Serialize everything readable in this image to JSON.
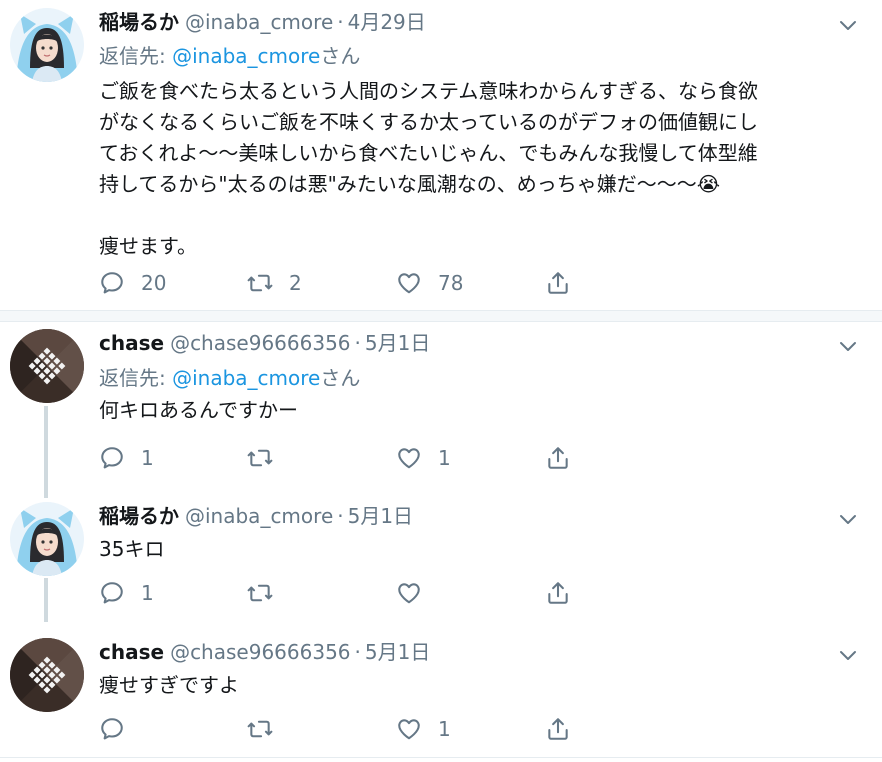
{
  "tweets": [
    {
      "name": "稲場るか",
      "handle": "@inaba_cmore",
      "dot": "·",
      "date": "4月29日",
      "reply_prefix": "返信先: ",
      "reply_handle": "@inaba_cmore",
      "reply_suffix": "さん",
      "text": "ご飯を食べたら太るという人間のシステム意味わからんすぎる、なら食欲\nがなくなるくらいご飯を不味くするか太っているのがデフォの価値観にし\nておくれよ〜〜美味しいから食べたいじゃん、でもみんな我慢して体型維\n持してるから\"太るのは悪\"みたいな風潮なの、めっちゃ嫌だ〜〜〜😭\n\n痩せます。",
      "replies": "20",
      "retweets": "2",
      "likes": "78"
    },
    {
      "name": "chase",
      "handle": "@chase96666356",
      "dot": "·",
      "date": "5月1日",
      "reply_prefix": "返信先: ",
      "reply_handle": "@inaba_cmore",
      "reply_suffix": "さん",
      "text": "何キロあるんですかー",
      "replies": "1",
      "retweets": "",
      "likes": "1"
    },
    {
      "name": "稲場るか",
      "handle": "@inaba_cmore",
      "dot": "·",
      "date": "5月1日",
      "text": "35キロ",
      "replies": "1",
      "retweets": "",
      "likes": ""
    },
    {
      "name": "chase",
      "handle": "@chase96666356",
      "dot": "·",
      "date": "5月1日",
      "text": "痩せすぎですよ",
      "replies": "",
      "retweets": "",
      "likes": "1"
    }
  ],
  "icons": {
    "reply": "reply-icon",
    "retweet": "retweet-icon",
    "like": "heart-icon",
    "share": "share-icon",
    "caret": "chevron-down-icon"
  },
  "colors": {
    "link": "#1b95e0",
    "secondary": "#657786",
    "divider": "#e6ecf0"
  }
}
